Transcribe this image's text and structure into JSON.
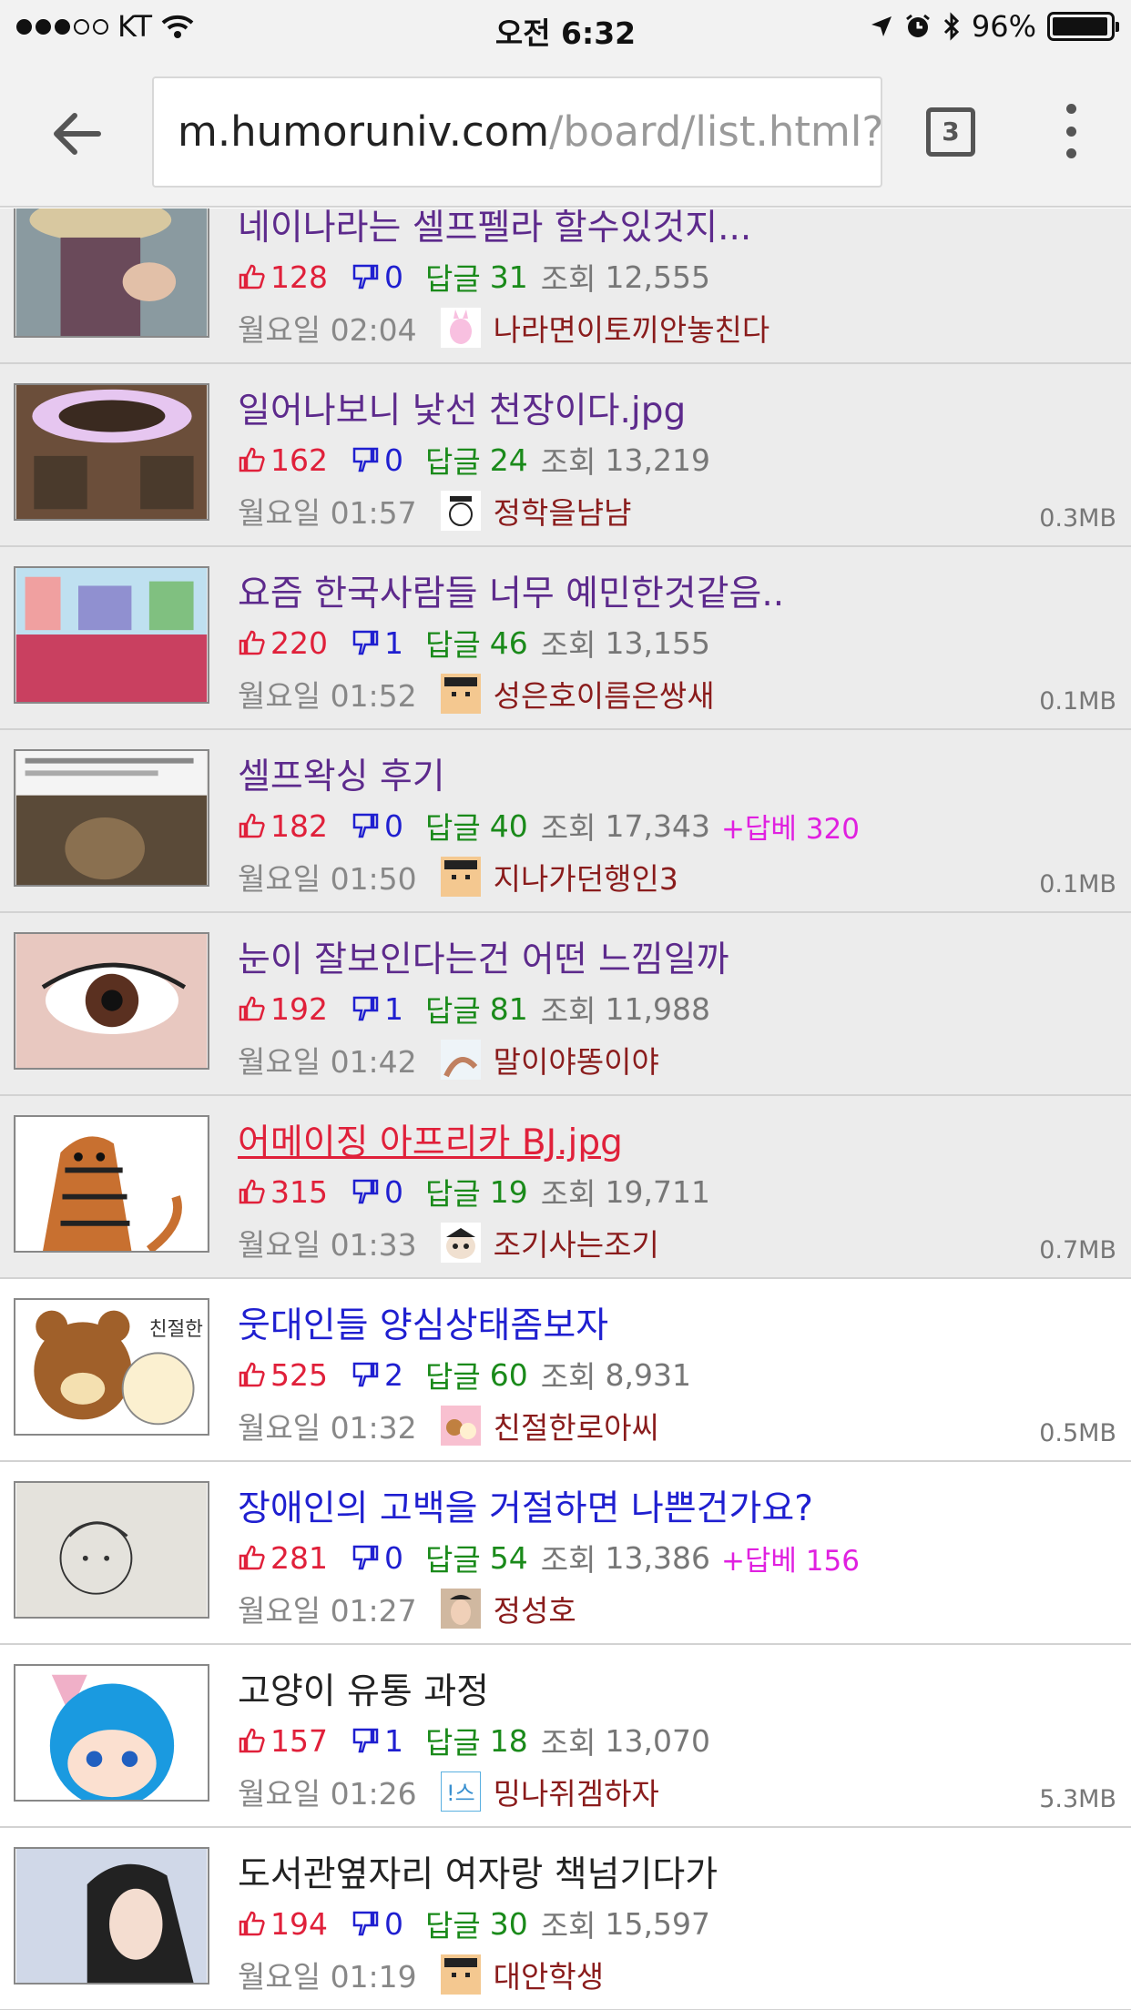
{
  "status_bar": {
    "carrier": "KT",
    "time": "오전 6:32",
    "battery": "96%",
    "battery_level": 0.96
  },
  "browser": {
    "url_host": "m.humoruniv.com",
    "url_path": "/board/list.html?t",
    "tab_count": "3"
  },
  "posts": [
    {
      "title": "네이나라는 셀프펠라 할수있것지...",
      "up": "128",
      "down": "0",
      "reply_label": "답글",
      "replies": "31",
      "view_label": "조회",
      "views": "12,555",
      "best": "",
      "time": "월요일 02:04",
      "author": "나라면이토끼안놓친다",
      "size": "",
      "state": "read",
      "title_style": "visited"
    },
    {
      "title": "일어나보니 낯선 천장이다.jpg",
      "up": "162",
      "down": "0",
      "reply_label": "답글",
      "replies": "24",
      "view_label": "조회",
      "views": "13,219",
      "best": "",
      "time": "월요일 01:57",
      "author": "정학을냠냠",
      "size": "0.3MB",
      "state": "read",
      "title_style": "visited"
    },
    {
      "title": "요즘 한국사람들 너무 예민한것같음..",
      "up": "220",
      "down": "1",
      "reply_label": "답글",
      "replies": "46",
      "view_label": "조회",
      "views": "13,155",
      "best": "",
      "time": "월요일 01:52",
      "author": "성은호이름은쌍새",
      "size": "0.1MB",
      "state": "read",
      "title_style": "visited"
    },
    {
      "title": "셀프왁싱 후기",
      "up": "182",
      "down": "0",
      "reply_label": "답글",
      "replies": "40",
      "view_label": "조회",
      "views": "17,343",
      "best": "+답베 320",
      "time": "월요일 01:50",
      "author": "지나가던행인3",
      "size": "0.1MB",
      "state": "read",
      "title_style": "visited"
    },
    {
      "title": "눈이 잘보인다는건 어떤 느낌일까",
      "up": "192",
      "down": "1",
      "reply_label": "답글",
      "replies": "81",
      "view_label": "조회",
      "views": "11,988",
      "best": "",
      "time": "월요일 01:42",
      "author": "말이야똥이야",
      "size": "",
      "state": "read",
      "title_style": "visited"
    },
    {
      "title": "어메이징 아프리카 BJ.jpg",
      "up": "315",
      "down": "0",
      "reply_label": "답글",
      "replies": "19",
      "view_label": "조회",
      "views": "19,711",
      "best": "",
      "time": "월요일 01:33",
      "author": "조기사는조기",
      "size": "0.7MB",
      "state": "read",
      "title_style": "active"
    },
    {
      "title": "웃대인들 양심상태좀보자",
      "up": "525",
      "down": "2",
      "reply_label": "답글",
      "replies": "60",
      "view_label": "조회",
      "views": "8,931",
      "best": "",
      "time": "월요일 01:32",
      "author": "친절한로아씨",
      "size": "0.5MB",
      "state": "unread",
      "title_style": "new"
    },
    {
      "title": "장애인의 고백을 거절하면 나쁜건가요?",
      "up": "281",
      "down": "0",
      "reply_label": "답글",
      "replies": "54",
      "view_label": "조회",
      "views": "13,386",
      "best": "+답베 156",
      "time": "월요일 01:27",
      "author": "정성호",
      "size": "",
      "state": "unread",
      "title_style": "new"
    },
    {
      "title": "고양이 유통 과정",
      "up": "157",
      "down": "1",
      "reply_label": "답글",
      "replies": "18",
      "view_label": "조회",
      "views": "13,070",
      "best": "",
      "time": "월요일 01:26",
      "author": "밍나쥐겜하자",
      "size": "5.3MB",
      "state": "unread",
      "title_style": "plain"
    },
    {
      "title": "도서관옆자리 여자랑 책넘기다가",
      "up": "194",
      "down": "0",
      "reply_label": "답글",
      "replies": "30",
      "view_label": "조회",
      "views": "15,597",
      "best": "",
      "time": "월요일 01:19",
      "author": "대안학생",
      "size": "",
      "state": "unread",
      "title_style": "plain"
    }
  ],
  "colors": {
    "up": "#e0203a",
    "down": "#1f1fd0",
    "reply": "#1a8a1a",
    "best": "#e020e0",
    "visited_title": "#5d2a8c",
    "author": "#8a1c1c"
  }
}
